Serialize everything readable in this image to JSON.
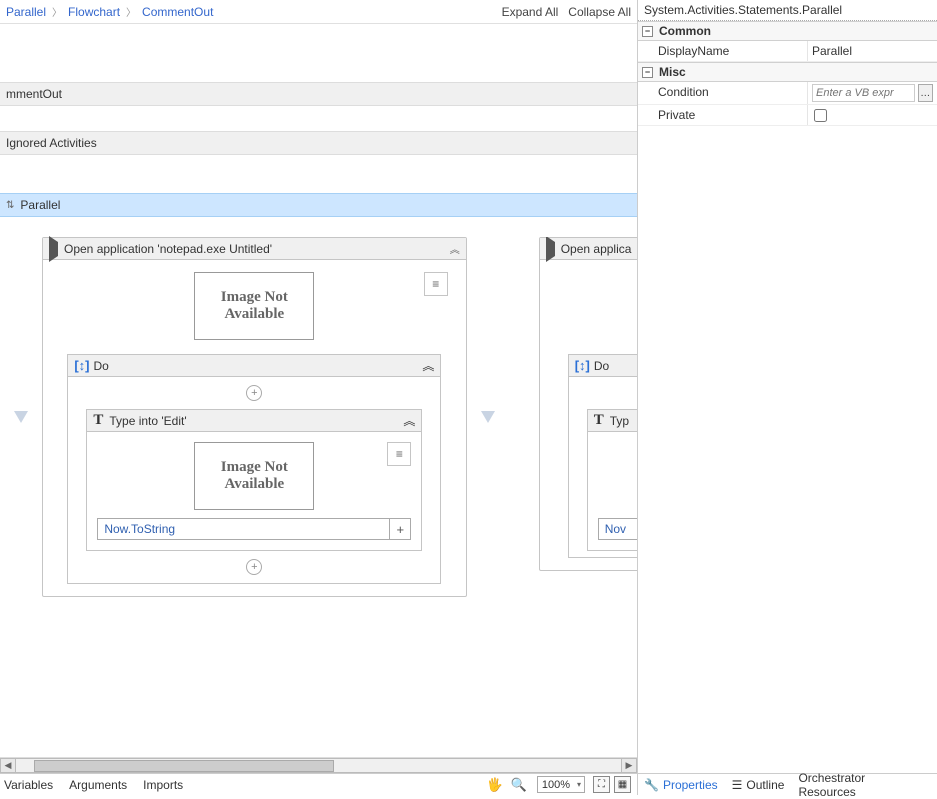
{
  "breadcrumbs": [
    "Parallel",
    "Flowchart",
    "CommentOut"
  ],
  "toolbar": {
    "expand": "Expand All",
    "collapse": "Collapse All"
  },
  "sections": {
    "commentout": "mmentOut",
    "ignored": "Ignored Activities",
    "parallel": "Parallel"
  },
  "openApp": {
    "title": "Open application 'notepad.exe Untitled'",
    "title2": "Open applica",
    "imgNA": "Image Not Available",
    "do": "Do",
    "typeTitle": "Type into 'Edit'",
    "typeTitle2": "Typ",
    "typeValue": "Now.ToString",
    "typeValue2": "Nov"
  },
  "bottom": {
    "variables": "Variables",
    "arguments": "Arguments",
    "imports": "Imports",
    "zoom": "100%"
  },
  "props": {
    "title": "System.Activities.Statements.Parallel",
    "cat1": "Common",
    "displayName": {
      "label": "DisplayName",
      "value": "Parallel"
    },
    "cat2": "Misc",
    "condition": {
      "label": "Condition",
      "placeholder": "Enter a VB expr"
    },
    "private": {
      "label": "Private"
    },
    "tabs": {
      "properties": "Properties",
      "outline": "Outline",
      "orch": "Orchestrator Resources"
    }
  }
}
